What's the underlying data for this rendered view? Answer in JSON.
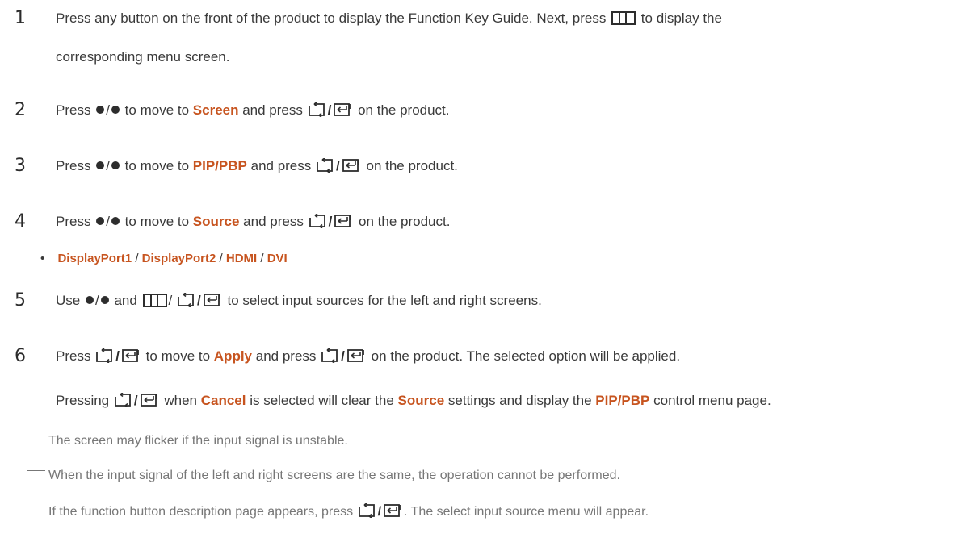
{
  "steps": [
    {
      "num": "1"
    },
    {
      "num": "2"
    },
    {
      "num": "3"
    },
    {
      "num": "4"
    },
    {
      "num": "5"
    },
    {
      "num": "6"
    }
  ],
  "text": {
    "s1a": "Press any button on the front of the product to display the Function Key Guide. Next, press",
    "s1b": "to display the",
    "s1c": "corresponding menu screen.",
    "press": "Press",
    "slash": "/",
    "to_move_to": "to move to",
    "and_press": "and press",
    "on_the_product": "on the product.",
    "use": "Use",
    "and": "and",
    "s5_tail": "to select input sources for the left and right screens.",
    "s6_tail": "on the product. The selected option will be applied.",
    "pressing": "Pressing",
    "when": "when",
    "is_selected": "is selected will clear the",
    "settings_display": "settings and display the",
    "control_menu_page": "control menu page."
  },
  "highlights": {
    "screen": "Screen",
    "pip_pbp": "PIP/PBP",
    "source": "Source",
    "apply": "Apply",
    "cancel": "Cancel"
  },
  "sources": [
    "DisplayPort1",
    "DisplayPort2",
    "HDMI",
    "DVI"
  ],
  "bullet_char": "•",
  "notes": [
    "The screen may flicker if the input signal is unstable.",
    "When the input signal of the left and right screens are the same, the operation cannot be performed.",
    "If the function button description page appears, press",
    ". The select input source menu will appear."
  ],
  "icons": [
    "dot-icon",
    "menu-icon",
    "return-icon",
    "enter-icon"
  ]
}
